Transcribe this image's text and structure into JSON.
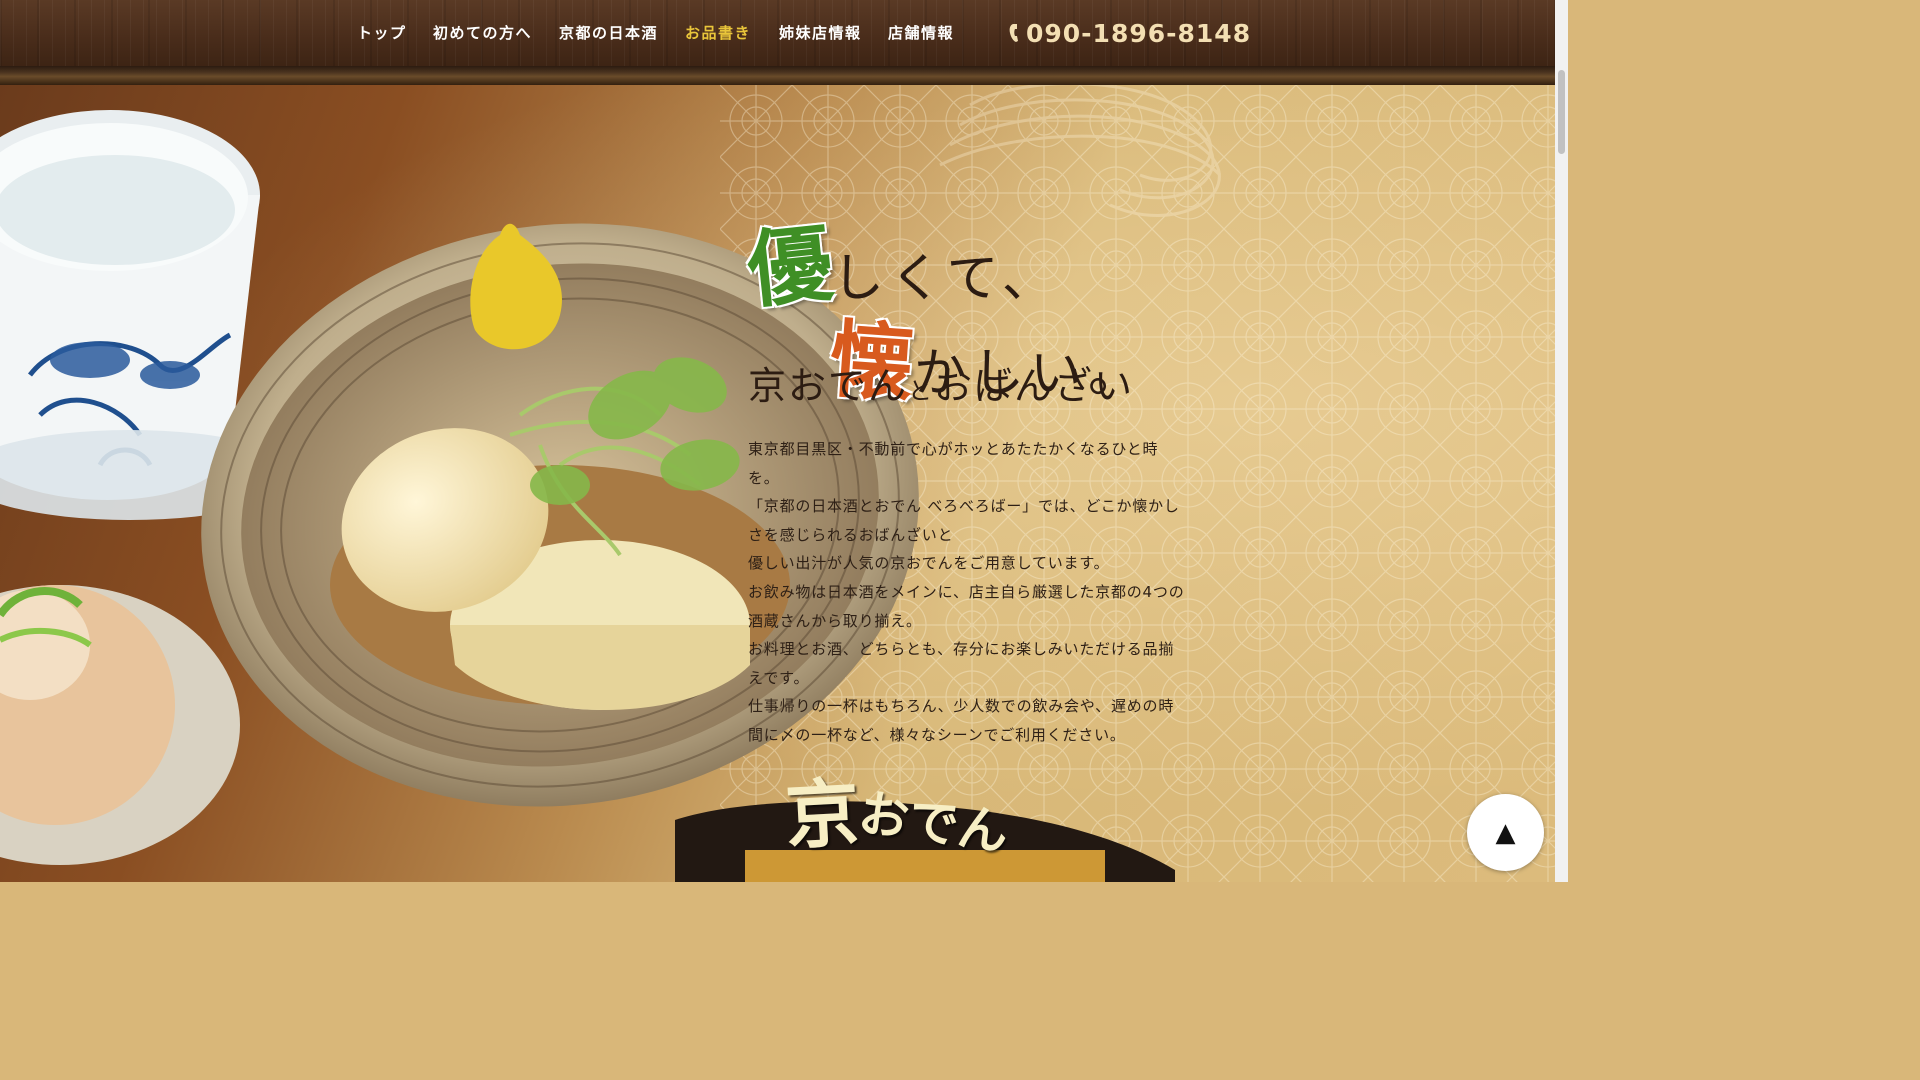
{
  "nav": {
    "items": [
      {
        "label": "トップ",
        "active": false
      },
      {
        "label": "初めての方へ",
        "active": false
      },
      {
        "label": "京都の日本酒",
        "active": false
      },
      {
        "label": "お品書き",
        "active": true
      },
      {
        "label": "姉妹店情報",
        "active": false
      },
      {
        "label": "店舗情報",
        "active": false
      }
    ],
    "phone": "090-1896-8148",
    "phone_icon": "phone-icon"
  },
  "hero": {
    "headline": {
      "line1_big": "優",
      "line1_rest": "しくて、",
      "line2_big": "懐",
      "line2_rest": "かしい。"
    },
    "subtitle_a": "京おでん",
    "subtitle_and": "と",
    "subtitle_b": "おばんざい",
    "paragraphs": [
      "東京都目黒区・不動前で心がホッとあたたかくなるひと時を。",
      "「京都の日本酒とおでん べろべろばー」では、どこか懐かしさを感じられるおばんざいと",
      "優しい出汁が人気の京おでんをご用意しています。",
      "お飲み物は日本酒をメインに、店主自ら厳選した京都の4つの酒蔵さんから取り揃え。",
      "お料理とお酒、どちらとも、存分にお楽しみいただける品揃えです。",
      "仕事帰りの一杯はもちろん、少人数での飲み会や、遅めの時間に〆の一杯など、様々なシーンでご利用ください。"
    ],
    "section_title_a": "京",
    "section_title_b": "おでん"
  },
  "back_to_top": "▲",
  "colors": {
    "accent_nav": "#e9c53a",
    "green": "#3f8f25",
    "orange": "#d85a1e",
    "text": "#2c1c12"
  }
}
